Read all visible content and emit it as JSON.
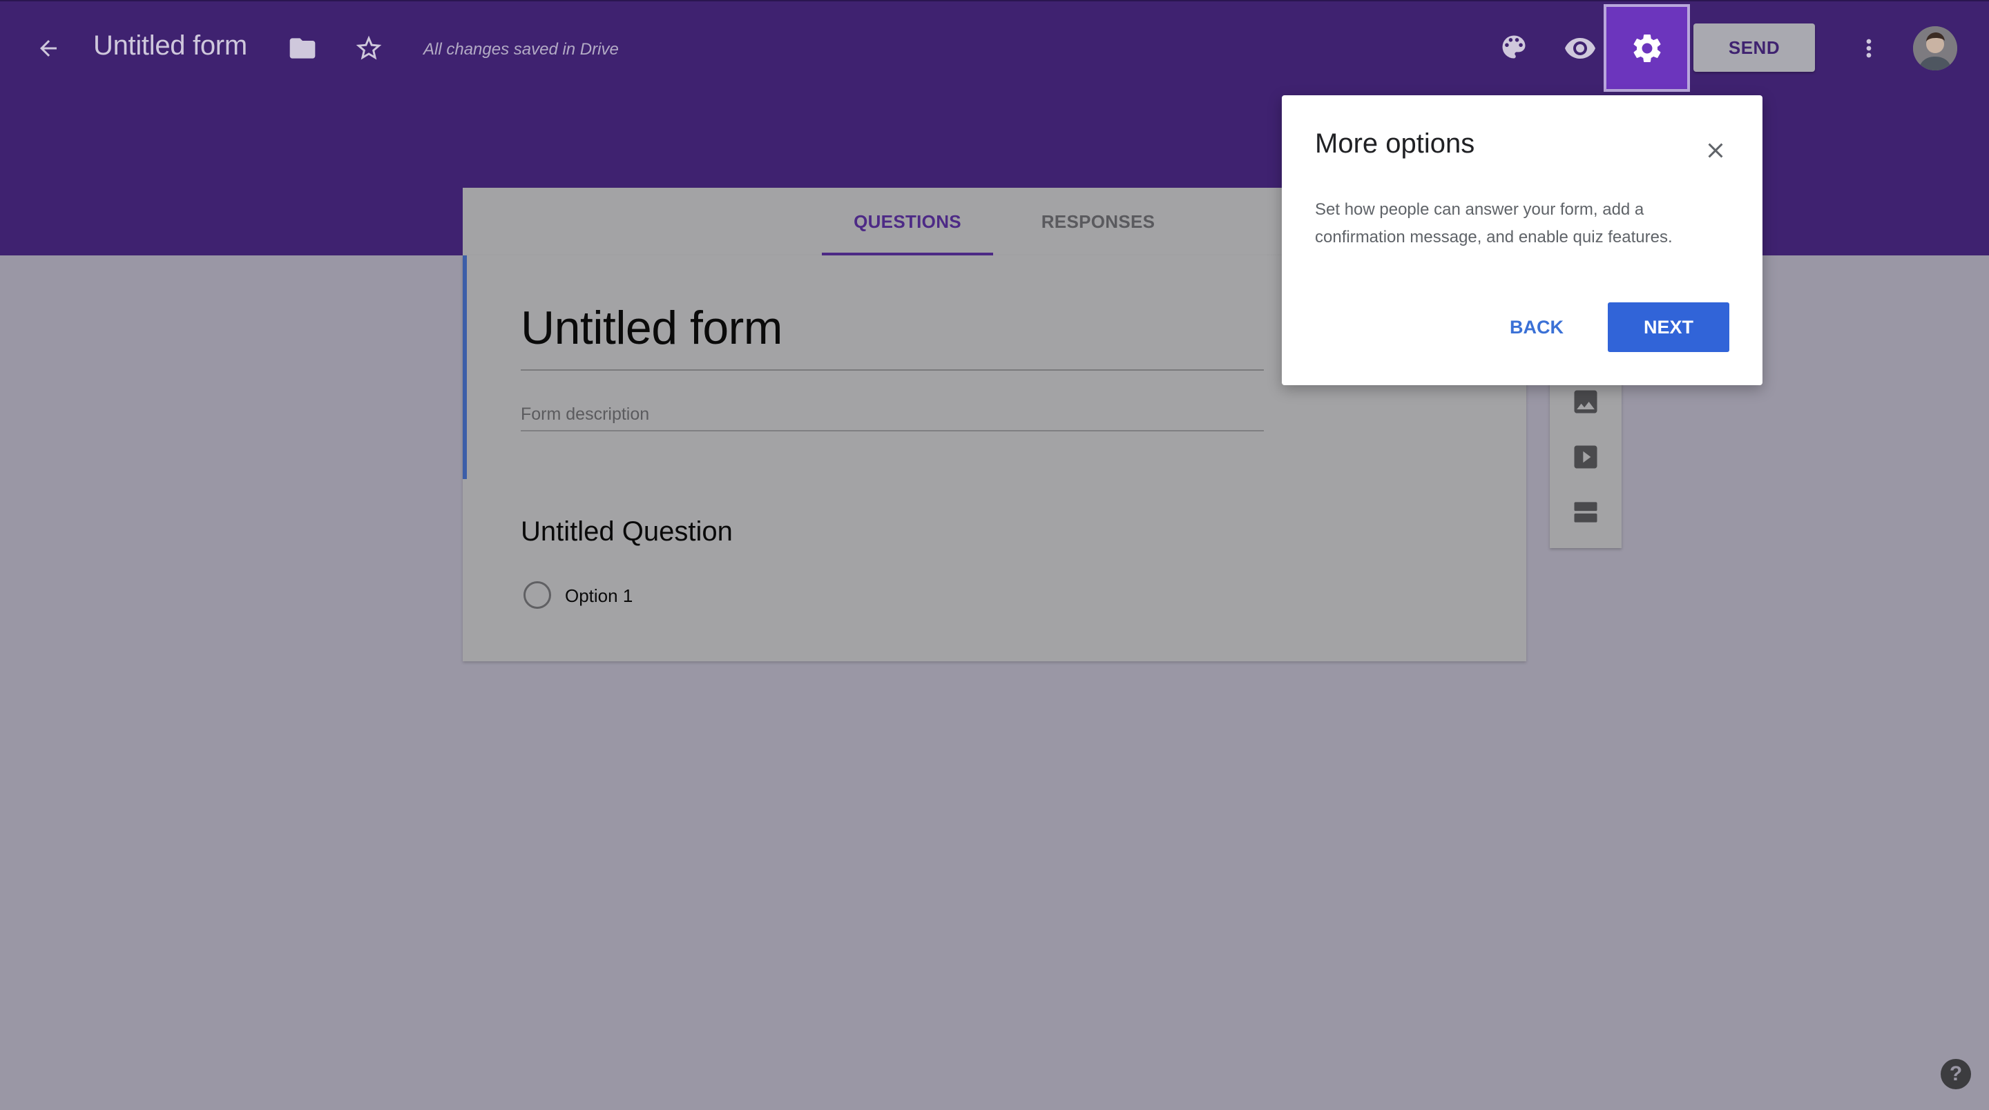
{
  "header": {
    "title": "Untitled form",
    "saved_status": "All changes saved in Drive",
    "send_label": "SEND",
    "icons": [
      "back-arrow-icon",
      "folder-icon",
      "star-icon",
      "palette-icon",
      "eye-icon",
      "gear-icon",
      "more-vert-icon"
    ]
  },
  "tabs": [
    {
      "label": "QUESTIONS",
      "active": true
    },
    {
      "label": "RESPONSES",
      "active": false
    }
  ],
  "form": {
    "title": "Untitled form",
    "description_placeholder": "Form description",
    "question": {
      "title": "Untitled Question",
      "options": [
        "Option 1"
      ]
    }
  },
  "side_toolbar": {
    "icons": [
      "image-icon",
      "video-icon",
      "section-icon"
    ]
  },
  "dialog": {
    "title": "More options",
    "body": "Set how people can answer your form, add a confirmation message, and enable quiz features.",
    "back_label": "BACK",
    "next_label": "NEXT"
  },
  "help": {
    "label": "?"
  },
  "colors": {
    "header_purple": "#3f2270",
    "settings_highlight": "#6c35bd",
    "accent_blue": "#3164d8",
    "overlay_gray": "#9a97a5"
  }
}
